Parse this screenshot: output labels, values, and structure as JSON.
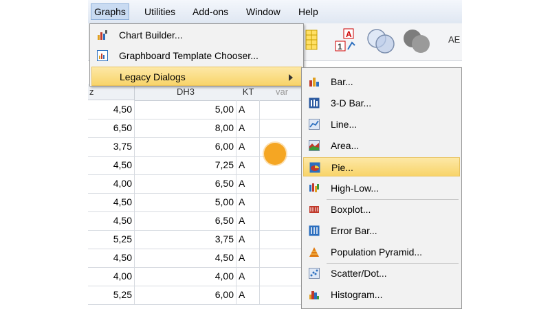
{
  "menubar": {
    "items": [
      "Graphs",
      "Utilities",
      "Add-ons",
      "Window",
      "Help"
    ],
    "active": "Graphs"
  },
  "toolbar": {
    "text_icon_label": "AE"
  },
  "grid": {
    "headers": [
      "z",
      "DH3",
      "KT",
      "var"
    ],
    "rows": [
      [
        "4,50",
        "5,00",
        "A"
      ],
      [
        "6,50",
        "8,00",
        "A"
      ],
      [
        "3,75",
        "6,00",
        "A"
      ],
      [
        "4,50",
        "7,25",
        "A"
      ],
      [
        "4,00",
        "6,50",
        "A"
      ],
      [
        "4,50",
        "5,00",
        "A"
      ],
      [
        "4,50",
        "6,50",
        "A"
      ],
      [
        "5,25",
        "3,75",
        "A"
      ],
      [
        "4,50",
        "4,50",
        "A"
      ],
      [
        "4,00",
        "4,00",
        "A"
      ],
      [
        "5,25",
        "6,00",
        "A"
      ]
    ]
  },
  "graphs_menu": {
    "items": [
      "Chart Builder...",
      "Graphboard Template Chooser...",
      "Legacy Dialogs"
    ],
    "highlighted": "Legacy Dialogs"
  },
  "legacy_menu": {
    "items": [
      "Bar...",
      "3-D Bar...",
      "Line...",
      "Area...",
      "Pie...",
      "High-Low...",
      "Boxplot...",
      "Error Bar...",
      "Population Pyramid...",
      "Scatter/Dot...",
      "Histogram..."
    ],
    "highlighted": "Pie..."
  },
  "colors": {
    "menu_highlight": "#f8d46a",
    "menubar_active": "#c9dbf2",
    "cursor": "#f5a623"
  }
}
